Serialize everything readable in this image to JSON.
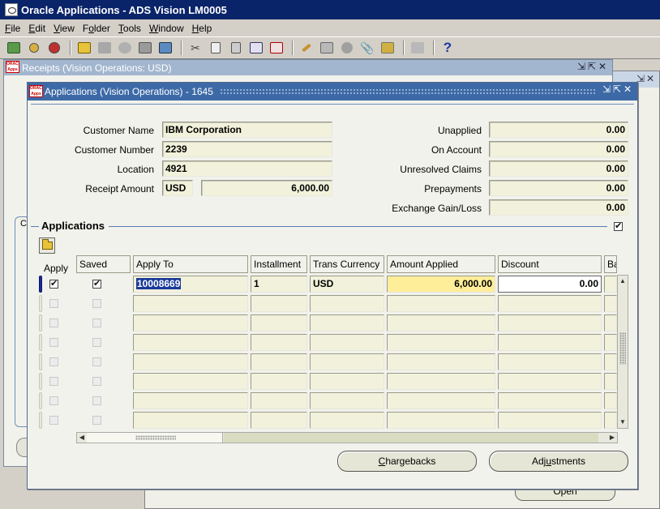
{
  "app": {
    "title": "Oracle Applications - ADS Vision LM0005"
  },
  "menu": {
    "items": [
      {
        "label": "File",
        "key": "F",
        "rest": "ile"
      },
      {
        "label": "Edit",
        "key": "E",
        "rest": "dit"
      },
      {
        "label": "View",
        "key": "V",
        "rest": "iew"
      },
      {
        "label": "Folder",
        "key": "F",
        "rest": "older",
        "keyIdx": 1
      },
      {
        "label": "Tools",
        "key": "T",
        "rest": "ools"
      },
      {
        "label": "Window",
        "key": "W",
        "rest": "indow"
      },
      {
        "label": "Help",
        "key": "H",
        "rest": "elp"
      }
    ]
  },
  "toolbar": {
    "help_glyph": "?"
  },
  "receipts_window": {
    "title": "Receipts (Vision Operations: USD)",
    "inner_tab_letter": "C"
  },
  "background_window": {
    "open_button_label": "Open"
  },
  "applications_window": {
    "title": "Applications (Vision Operations) - 1645",
    "customer_name_label": "Customer Name",
    "customer_name": "IBM Corporation",
    "customer_number_label": "Customer Number",
    "customer_number": "2239",
    "location_label": "Location",
    "location": "4921",
    "receipt_amount_label": "Receipt Amount",
    "receipt_currency": "USD",
    "receipt_amount": "6,000.00",
    "unapplied_label": "Unapplied",
    "unapplied": "0.00",
    "on_account_label": "On Account",
    "on_account": "0.00",
    "unresolved_claims_label": "Unresolved Claims",
    "unresolved_claims": "0.00",
    "prepayments_label": "Prepayments",
    "prepayments": "0.00",
    "exchange_label": "Exchange Gain/Loss",
    "exchange": "0.00",
    "section_title": "Applications",
    "columns": {
      "apply": "Apply",
      "saved": "Saved",
      "apply_to": "Apply To",
      "installment": "Installment",
      "trans_currency": "Trans Currency",
      "amount_applied": "Amount Applied",
      "discount": "Discount",
      "balance": "Ba"
    },
    "rows": [
      {
        "apply": true,
        "saved": true,
        "apply_to": "10008669",
        "installment": "1",
        "trans_currency": "USD",
        "amount_applied": "6,000.00",
        "discount": "0.00"
      }
    ],
    "empty_row_count": 7,
    "buttons": {
      "chargebacks": "Chargebacks",
      "chargebacks_key": "C",
      "chargebacks_rest": "hargebacks",
      "adjustments_pre": "Adj",
      "adjustments_key": "u",
      "adjustments_rest": "stments"
    }
  }
}
